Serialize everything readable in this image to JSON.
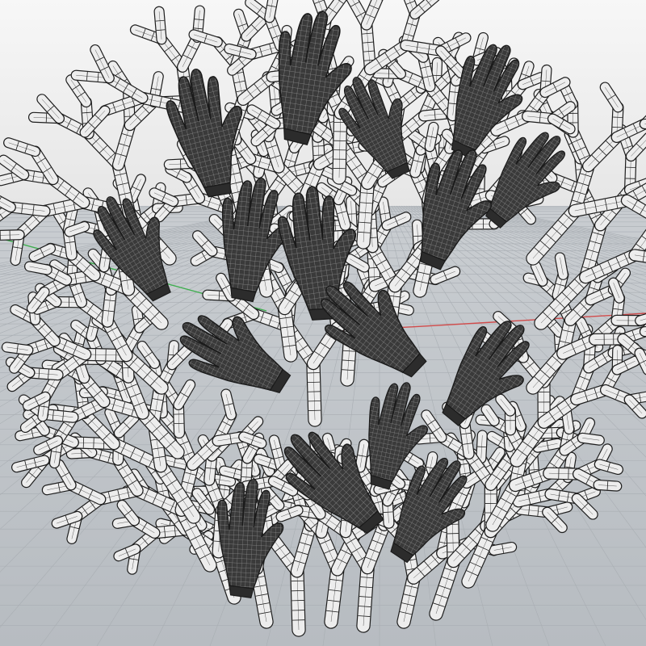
{
  "viewport": {
    "projection": "perspective",
    "display_mode": "wireframe-shaded",
    "background_sky": "#f2f2f2",
    "background_floor": "#bfc4c8",
    "grid_color": "#a9aeb3",
    "x_axis_color": "#d14b4b",
    "y_axis_color": "#3fae4f"
  },
  "model": {
    "description_icon": "branching-coral-with-hands",
    "branch_fill": "#ededed",
    "branch_edge": "#1e1e1e",
    "hand_fill": "#3a3a3a",
    "hand_mesh": "#8e8e8e",
    "hand_count": 16
  }
}
